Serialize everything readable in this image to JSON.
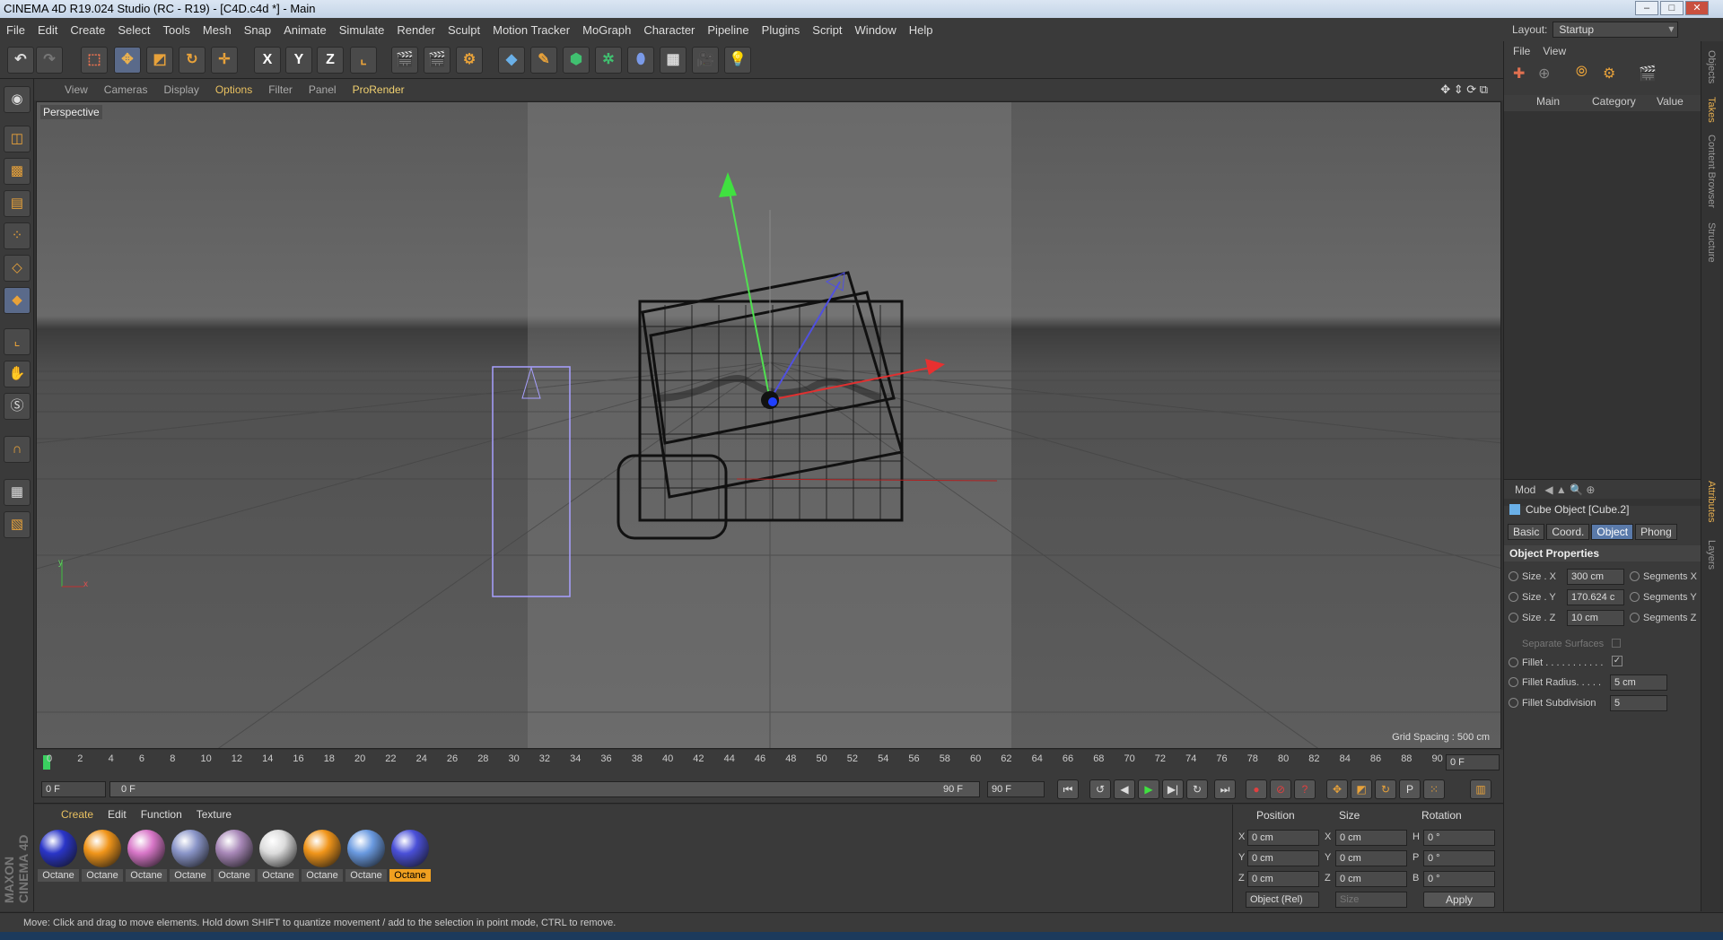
{
  "titlebar": {
    "title": "CINEMA 4D R19.024 Studio (RC - R19) - [C4D.c4d *] - Main",
    "min": "–",
    "max": "□",
    "close": "✕"
  },
  "menu": [
    "File",
    "Edit",
    "Create",
    "Select",
    "Tools",
    "Mesh",
    "Snap",
    "Animate",
    "Simulate",
    "Render",
    "Sculpt",
    "Motion Tracker",
    "MoGraph",
    "Character",
    "Pipeline",
    "Plugins",
    "Script",
    "Window",
    "Help"
  ],
  "layout": {
    "label": "Layout:",
    "value": "Startup"
  },
  "toolbar": {
    "x_label": "X",
    "y_label": "Y",
    "z_label": "Z"
  },
  "viewport_menu": [
    "View",
    "Cameras",
    "Display",
    "Options",
    "Filter",
    "Panel",
    "ProRender"
  ],
  "viewport": {
    "label": "Perspective",
    "grid_spacing": "Grid Spacing : 500 cm",
    "axis_y": "y",
    "axis_x": "x"
  },
  "timeline": {
    "ticks": [
      "0",
      "2",
      "4",
      "6",
      "8",
      "10",
      "12",
      "14",
      "16",
      "18",
      "20",
      "22",
      "24",
      "26",
      "28",
      "30",
      "32",
      "34",
      "36",
      "38",
      "40",
      "42",
      "44",
      "46",
      "48",
      "50",
      "52",
      "54",
      "56",
      "58",
      "60",
      "62",
      "64",
      "66",
      "68",
      "70",
      "72",
      "74",
      "76",
      "78",
      "80",
      "82",
      "84",
      "86",
      "88",
      "90"
    ],
    "current_frame": "0 F"
  },
  "transport": {
    "start": "0 F",
    "range_start": "0 F",
    "range_end": "90 F",
    "end": "90 F"
  },
  "material_manager": {
    "tabs": [
      "Create",
      "Edit",
      "Function",
      "Texture"
    ],
    "materials": [
      {
        "name": "Octane",
        "color": "#2a35c8"
      },
      {
        "name": "Octane",
        "color": "#f0951a"
      },
      {
        "name": "Octane",
        "color": "#d877c8"
      },
      {
        "name": "Octane",
        "color": "#8a95c8"
      },
      {
        "name": "Octane",
        "color": "#a888b8"
      },
      {
        "name": "Octane",
        "color": "#dcdcdc"
      },
      {
        "name": "Octane",
        "color": "#f0951a"
      },
      {
        "name": "Octane",
        "color": "#6a9ae0"
      },
      {
        "name": "Octane",
        "color": "#4a50d8"
      }
    ]
  },
  "brand": "MAXON CINEMA 4D",
  "coordinates": {
    "position_label": "Position",
    "size_label": "Size",
    "rotation_label": "Rotation",
    "rows": [
      {
        "axis": "X",
        "pos": "0 cm",
        "size_axis": "X",
        "size": "0 cm",
        "rot_axis": "H",
        "rot": "0 °"
      },
      {
        "axis": "Y",
        "pos": "0 cm",
        "size_axis": "Y",
        "size": "0 cm",
        "rot_axis": "P",
        "rot": "0 °"
      },
      {
        "axis": "Z",
        "pos": "0 cm",
        "size_axis": "Z",
        "size": "0 cm",
        "rot_axis": "B",
        "rot": "0 °"
      }
    ],
    "mode": "Object (Rel)",
    "size_mode": "Size",
    "apply": "Apply"
  },
  "status": "Move: Click and drag to move elements. Hold down SHIFT to quantize movement / add to the selection in point mode, CTRL to remove.",
  "objects_panel": {
    "menu": [
      "File",
      "View"
    ],
    "col_main": "Main",
    "col_category": "Category",
    "col_value": "Value"
  },
  "attributes": {
    "menu": "Mod",
    "title": "Cube Object [Cube.2]",
    "tabs": [
      "Basic",
      "Coord.",
      "Object",
      "Phong"
    ],
    "section": "Object Properties",
    "props": [
      {
        "label": "Size . X",
        "value": "300 cm",
        "seg": "Segments X"
      },
      {
        "label": "Size . Y",
        "value": "170.624 c",
        "seg": "Segments Y"
      },
      {
        "label": "Size . Z",
        "value": "10 cm",
        "seg": "Segments Z"
      }
    ],
    "separate": "Separate Surfaces",
    "fillet": "Fillet . . . . . . . . . . .",
    "fillet_check": "✓",
    "fillet_radius_label": "Fillet Radius. . . . .",
    "fillet_radius": "5 cm",
    "fillet_sub_label": "Fillet Subdivision",
    "fillet_sub": "5"
  },
  "side_tabs": [
    "Objects",
    "Takes",
    "Content Browser",
    "Structure",
    "Attributes",
    "Layers"
  ]
}
